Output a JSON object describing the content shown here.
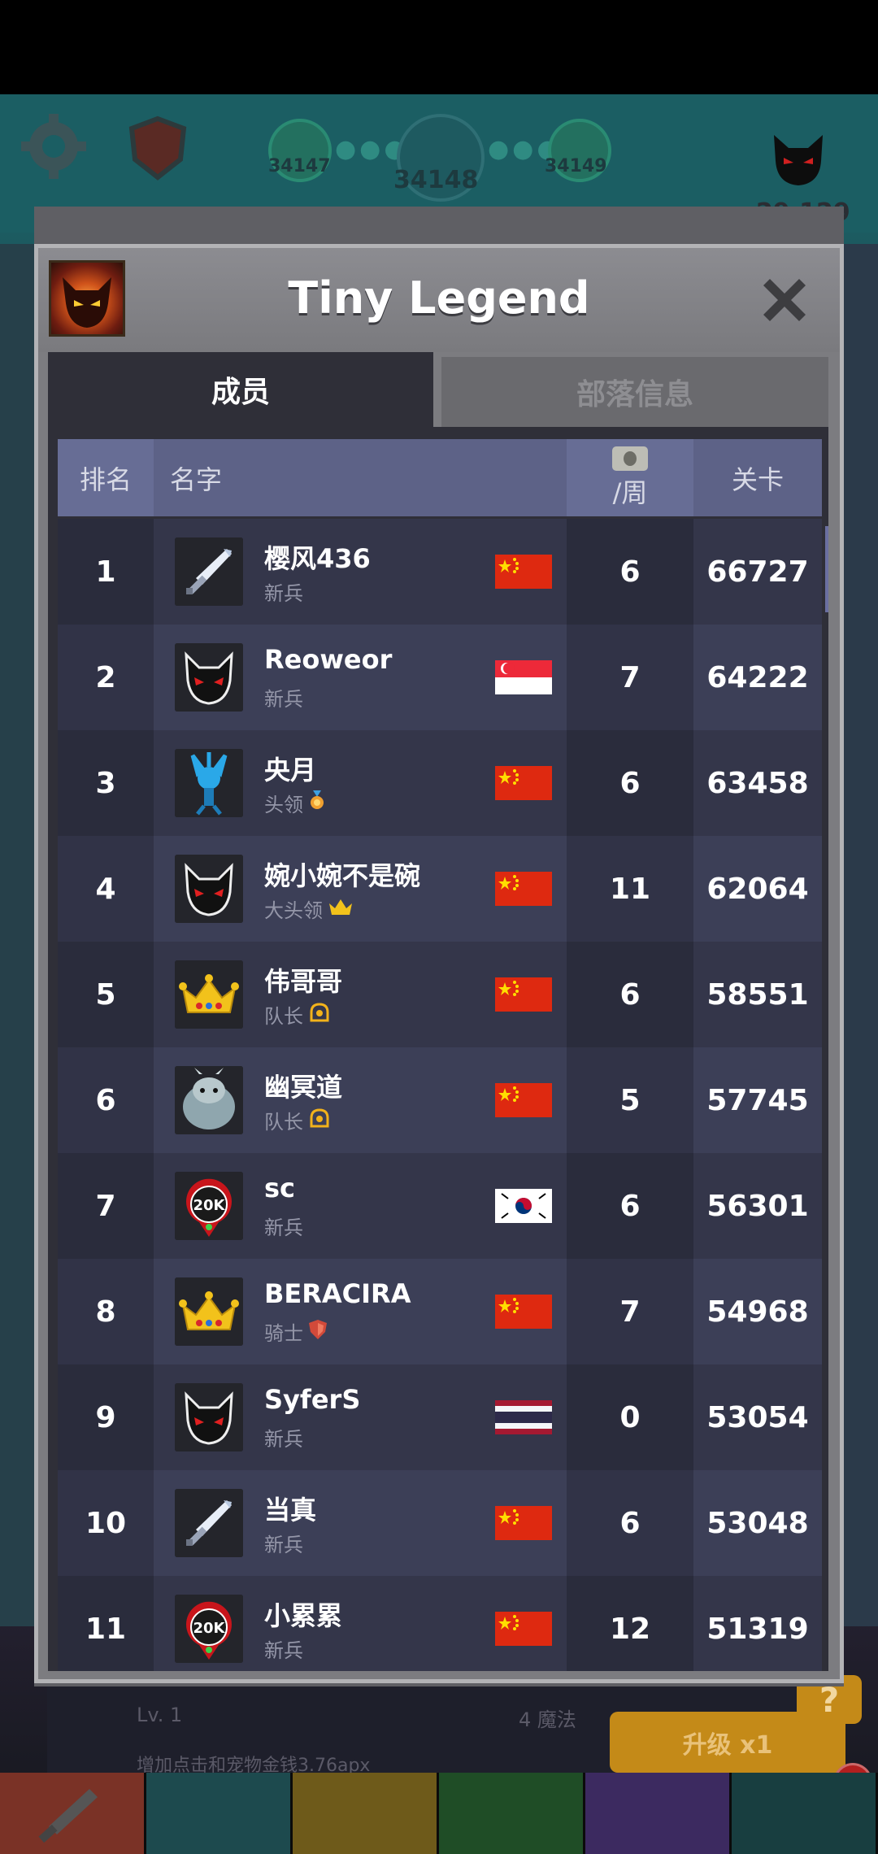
{
  "background": {
    "stages": {
      "prev": "34147",
      "current": "34148",
      "next": "34149"
    },
    "partial_number": "29,129",
    "bottom_panel": {
      "level": "Lv. 1",
      "magic": "4 魔法",
      "description": "增加点击和宠物金钱3.76apx",
      "upgrade_label": "升级 x1",
      "help_label": "?",
      "alert_label": "!"
    },
    "tab_colors": [
      "#c8452e",
      "#1f6f73",
      "#c39a20",
      "#2f7a36",
      "#5b3f9a",
      "#1c5c5e"
    ]
  },
  "modal": {
    "title": "Tiny Legend",
    "tabs": {
      "members": "成员",
      "info": "部落信息"
    },
    "columns": {
      "rank": "排名",
      "name": "名字",
      "week": "/周",
      "level": "关卡"
    }
  },
  "members": [
    {
      "rank": "1",
      "name": "樱风436",
      "role": "新兵",
      "role_icon": "",
      "avatar": "sword",
      "flag": "cn",
      "week": "6",
      "level": "66727"
    },
    {
      "rank": "2",
      "name": "Reoweor",
      "role": "新兵",
      "role_icon": "",
      "avatar": "devil",
      "flag": "sg",
      "week": "7",
      "level": "64222"
    },
    {
      "rank": "3",
      "name": "央月",
      "role": "头领",
      "role_icon": "medal-icon",
      "avatar": "wizard",
      "flag": "cn",
      "week": "6",
      "level": "63458"
    },
    {
      "rank": "4",
      "name": "婉小婉不是碗",
      "role": "大头领",
      "role_icon": "crown-icon",
      "avatar": "devil",
      "flag": "cn",
      "week": "11",
      "level": "62064"
    },
    {
      "rank": "5",
      "name": "伟哥哥",
      "role": "队长",
      "role_icon": "helmet-icon",
      "avatar": "crown",
      "flag": "cn",
      "week": "6",
      "level": "58551"
    },
    {
      "rank": "6",
      "name": "幽冥道",
      "role": "队长",
      "role_icon": "helmet-icon",
      "avatar": "yeti",
      "flag": "cn",
      "week": "5",
      "level": "57745"
    },
    {
      "rank": "7",
      "name": "sc",
      "role": "新兵",
      "role_icon": "",
      "avatar": "20k",
      "flag": "kr",
      "week": "6",
      "level": "56301"
    },
    {
      "rank": "8",
      "name": "BERACIRA",
      "role": "骑士",
      "role_icon": "shield-icon",
      "avatar": "crown",
      "flag": "cn",
      "week": "7",
      "level": "54968"
    },
    {
      "rank": "9",
      "name": "SyferS",
      "role": "新兵",
      "role_icon": "",
      "avatar": "devil",
      "flag": "th",
      "week": "0",
      "level": "53054"
    },
    {
      "rank": "10",
      "name": "当真",
      "role": "新兵",
      "role_icon": "",
      "avatar": "sword",
      "flag": "cn",
      "week": "6",
      "level": "53048"
    },
    {
      "rank": "11",
      "name": "小累累",
      "role": "新兵",
      "role_icon": "",
      "avatar": "20k",
      "flag": "cn",
      "week": "12",
      "level": "51319"
    }
  ],
  "avatar_text": {
    "20k": "20K"
  }
}
